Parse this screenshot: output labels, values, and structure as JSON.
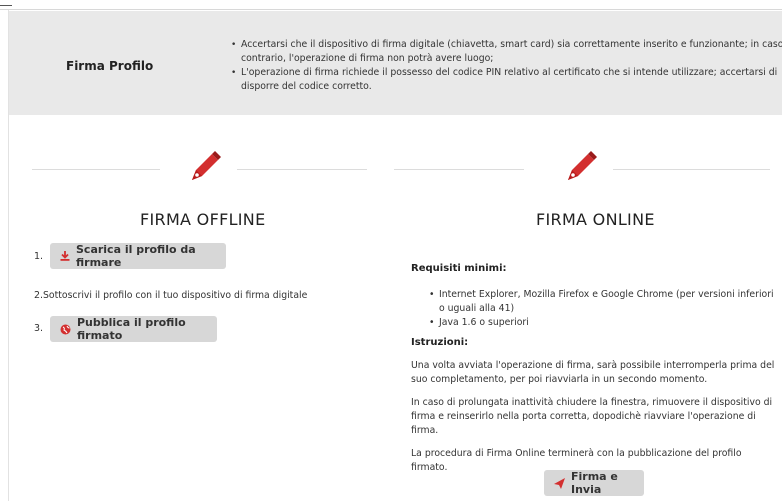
{
  "profile": {
    "title": "Firma Profilo",
    "notes": [
      "Accertarsi che il dispositivo di firma digitale (chiavetta, smart card) sia correttamente inserito e funzionante; in caso contrario, l'operazione di firma non potrà avere luogo;",
      "L'operazione di firma richiede il possesso del codice PIN relativo al certificato che si intende utilizzare; accertarsi di disporre del codice corretto."
    ]
  },
  "offline": {
    "title": "FIRMA OFFLINE",
    "steps": [
      {
        "num": "1.",
        "button": "Scarica il profilo da firmare",
        "icon": "download-icon"
      },
      {
        "num": "2.",
        "text": "Sottoscrivi il profilo con il tuo dispositivo di firma digitale"
      },
      {
        "num": "3.",
        "button": "Pubblica il profilo firmato",
        "icon": "globe-icon"
      }
    ]
  },
  "online": {
    "title": "FIRMA ONLINE",
    "requirements_heading": "Requisiti minimi:",
    "requirements": [
      "Internet Explorer, Mozilla Firefox e Google Chrome (per versioni inferiori o uguali alla 41)",
      "Java 1.6 o superiori"
    ],
    "instructions_heading": "Istruzioni:",
    "instructions": [
      "Una volta avviata l'operazione di firma, sarà possibile interromperla prima del suo completamento, per poi riavviarla in un secondo momento.",
      "In caso di prolungata inattività chiudere la finestra, rimuovere il dispositivo di firma e reinserirlo nella porta corretta, dopodichè riavviare l'operazione di firma.",
      "La procedura di Firma Online terminerà con la pubblicazione del profilo firmato."
    ],
    "button": "Firma e Invia",
    "button_icon": "send-icon"
  },
  "colors": {
    "accent": "#d32f2f",
    "panel": "#e9e9e9",
    "button": "#d7d7d7"
  }
}
